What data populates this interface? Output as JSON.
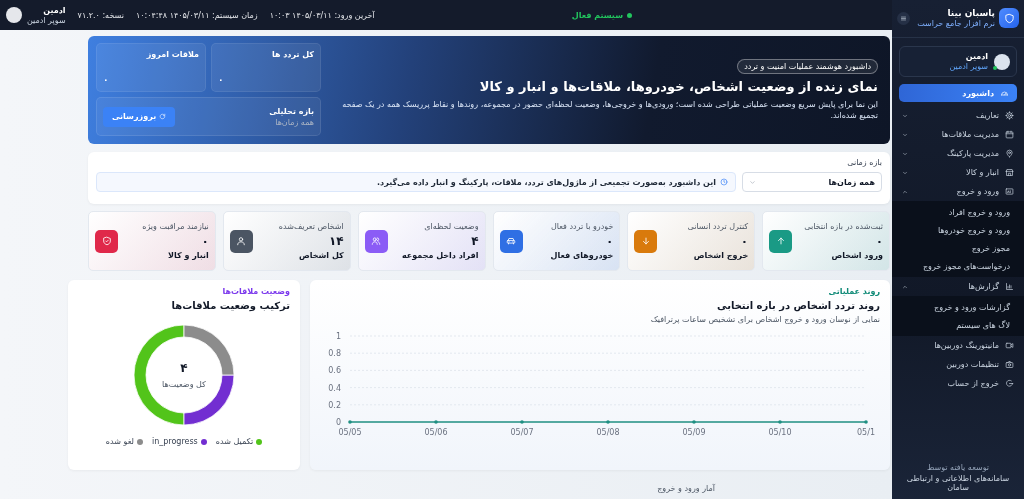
{
  "top_bar": {
    "system_status": {
      "label": "سیستم فعال",
      "online": true
    },
    "last_login": "آخرین ورود: ۱۴۰۵/۰۳/۱۱ ۱۰:۰۳",
    "system_time": "زمان سیستم: ۱۴۰۵/۰۳/۱۱ ۱۰:۰۴:۴۸",
    "version": "نسخه: ۷۱.۲.۰",
    "user": {
      "name": "ادمین",
      "role": "سوپر ادمین"
    }
  },
  "sidebar": {
    "brand": {
      "name": "پاسبان بینا",
      "tagline": "نرم افزار جامع حراست"
    },
    "user": {
      "name": "ادمین",
      "role": "سوپر ادمین",
      "online": true
    },
    "items": [
      {
        "label": "داشبورد",
        "selected": true
      },
      {
        "label": "تعاریف",
        "selected": false,
        "expanded": false
      },
      {
        "label": "مدیریت ملاقات‌ها",
        "selected": false,
        "expanded": false
      },
      {
        "label": "مدیریت پارکینگ",
        "selected": false,
        "expanded": false
      },
      {
        "label": "انبار و کالا",
        "selected": false,
        "expanded": false
      },
      {
        "label": "ورود و خروج",
        "selected": false,
        "expanded": true,
        "children": [
          {
            "label": "ورود و خروج افراد",
            "selected": false
          },
          {
            "label": "ورود و خروج خودروها",
            "selected": false
          },
          {
            "label": "مجوز خروج",
            "selected": false
          },
          {
            "label": "درخواست‌های مجوز خروج",
            "selected": false
          }
        ]
      },
      {
        "label": "گزارش‌ها",
        "selected": false,
        "expanded": true,
        "children": [
          {
            "label": "گزارشات ورود و خروج",
            "selected": false
          },
          {
            "label": "لاگ های سیستم",
            "selected": false
          }
        ]
      },
      {
        "label": "مانیتورینگ دوربین‌ها",
        "selected": false
      },
      {
        "label": "تنظیمات دوربین",
        "selected": false
      },
      {
        "label": "خروج از حساب",
        "selected": false
      }
    ],
    "footer": {
      "line_1": "توسعه یافته توسط",
      "line_2": "سامانه‌های اطلاعاتی و ارتباطی سامان"
    }
  },
  "hero": {
    "badge": "داشبورد هوشمند عملیات امنیت و تردد",
    "title": "نمای زنده از وضعیت اشخاص، خودروها، ملاقات‌ها و انبار و کالا",
    "description": "این نما برای پایش سریع وضعیت عملیاتی طراحی شده است؛ ورودی‌ها و خروجی‌ها، وضعیت لحظه‌ای حضور در مجموعه، روندها و نقاط پرریسک همه در یک صفحه تجمیع شده‌اند.",
    "tiles": [
      {
        "label": "کل تردد ها",
        "value": "۰"
      },
      {
        "label": "ملاقات امروز",
        "value": "۰"
      }
    ],
    "range": {
      "label": "بازه تحلیلی",
      "value": "همه زمان‌ها",
      "button": "بروزرسانی"
    }
  },
  "filter": {
    "label": "بازه زمانی",
    "select": "همه زمان‌ها",
    "info": "این داشبورد به‌صورت تجمیعی از ماژول‌های تردد، ملاقات، پارکینگ و انبار داده می‌گیرد."
  },
  "stat_cards": [
    {
      "caption": "ثبت‌شده در بازه انتخابی",
      "value": "۰",
      "label": "ورود اشخاص",
      "color": "#1a9a85"
    },
    {
      "caption": "کنترل تردد انسانی",
      "value": "۰",
      "label": "خروج اشخاص",
      "color": "#d97a0c"
    },
    {
      "caption": "خودرو با تردد فعال",
      "value": "۰",
      "label": "خودروهای فعال",
      "color": "#2f6fe4"
    },
    {
      "caption": "وضعیت لحظه‌ای",
      "value": "۴",
      "label": "افراد داخل مجموعه",
      "color": "#8b5cf6"
    },
    {
      "caption": "اشخاص تعریف‌شده",
      "value": "۱۴",
      "label": "کل اشخاص",
      "color": "#4b5563"
    },
    {
      "caption": "نیازمند مراقبت ویژه",
      "value": "۰",
      "label": "انبار و کالا",
      "color": "#e0284a"
    }
  ],
  "trend_card": {
    "eyebrow": "روند عملیاتی",
    "title": "روند تردد اشخاص در بازه انتخابی",
    "subtitle": "نمایی از نوسان ورود و خروج اشخاص برای تشخیص ساعات پرترافیک",
    "chart_data": {
      "type": "line",
      "categories": [
        "05/05",
        "05/06",
        "05/07",
        "05/08",
        "05/09",
        "05/10",
        "05/1"
      ],
      "series": [
        {
          "color": "#1f8f82",
          "values": [
            0,
            0,
            0,
            0,
            0,
            0,
            0
          ]
        }
      ],
      "ylim": [
        0,
        1
      ],
      "yticks": [
        0,
        0.2,
        0.4,
        0.6,
        0.8,
        1
      ],
      "grid": true
    }
  },
  "donut_card": {
    "eyebrow": "وضعیت ملاقات‌ها",
    "title": "ترکیب وضعیت ملاقات‌ها",
    "total": "۴",
    "total_label": "کل وضعیت‌ها",
    "chart_data": {
      "type": "donut",
      "categories": [
        "تکمیل شده",
        "in_progress",
        "لغو شده"
      ],
      "values": [
        50,
        25,
        25
      ],
      "legend": "bottom",
      "colors": [
        "#52c41a",
        "#722ed1",
        "#8c8c8c"
      ]
    }
  },
  "section_title": "آمار ورود و خروج"
}
